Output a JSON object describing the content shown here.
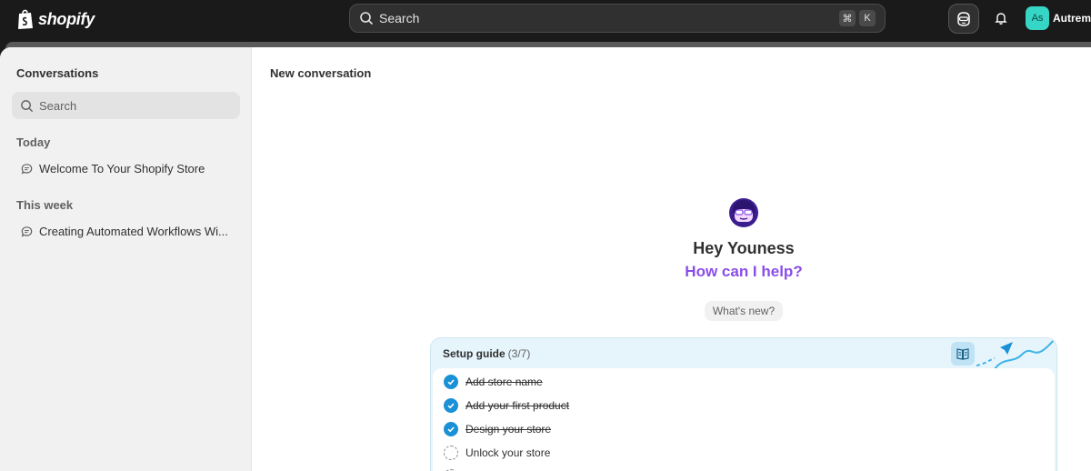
{
  "topbar": {
    "logo_text": "shopify",
    "search_placeholder": "Search",
    "shortcut_keys": [
      "⌘",
      "K"
    ],
    "avatar_initials": "As",
    "store_name": "Autreme"
  },
  "sidebar": {
    "title": "Conversations",
    "search_placeholder": "Search",
    "sections": [
      {
        "label": "Today",
        "items": [
          "Welcome To Your Shopify Store"
        ]
      },
      {
        "label": "This week",
        "items": [
          "Creating Automated Workflows Wi..."
        ]
      }
    ]
  },
  "main": {
    "title": "New conversation",
    "greeting": "Hey Youness",
    "prompt": "How can I help?",
    "whats_new_label": "What's new?",
    "accent_color": "#8a4ee8"
  },
  "setup_guide": {
    "title": "Setup guide",
    "count": "(3/7)",
    "tasks": [
      {
        "label": "Add store name",
        "done": true
      },
      {
        "label": "Add your first product",
        "done": true
      },
      {
        "label": "Design your store",
        "done": true
      },
      {
        "label": "Unlock your store",
        "done": false
      }
    ]
  },
  "icons": {
    "search": "search-icon",
    "sidekick": "sidekick-icon",
    "bell": "bell-icon",
    "chat": "chat-bubble-icon",
    "book": "book-icon",
    "check": "check-circle-icon",
    "todo": "dashed-circle-icon"
  }
}
